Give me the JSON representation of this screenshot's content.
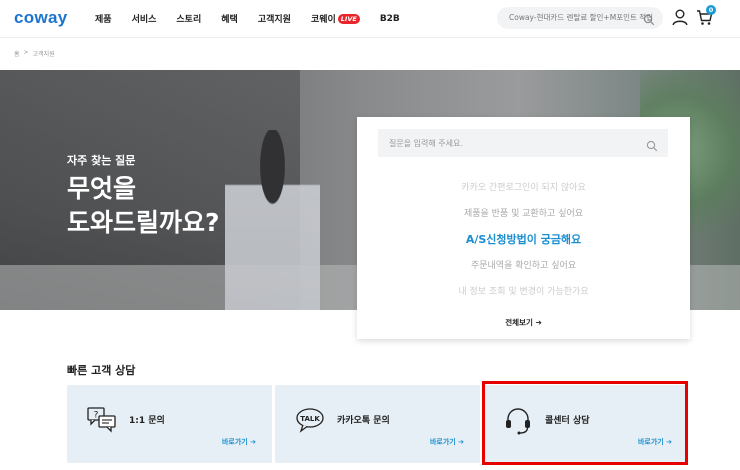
{
  "header": {
    "logo": "coway",
    "nav": [
      "제품",
      "서비스",
      "스토리",
      "혜택",
      "고객지원",
      "코웨이"
    ],
    "live_badge": "LIVE",
    "nav_b2b": "B2B",
    "search_text": "Coway-현대카드 렌탈료 할인+M포인트 적립",
    "cart_count": "0"
  },
  "breadcrumb": [
    "홈",
    ">",
    "고객지원"
  ],
  "hero": {
    "subtitle": "자주 찾는 질문",
    "title_line1": "무엇을",
    "title_line2": "도와드릴까요?"
  },
  "faq": {
    "placeholder": "질문을 입력해 주세요.",
    "items": [
      "카카오 간편로그인이 되지 않아요",
      "제품을 반품 및 교환하고 싶어요",
      "A/S신청방법이 궁금해요",
      "주문내역을 확인하고 싶어요",
      "내 정보 조회 및 변경이 가능한가요"
    ],
    "view_all": "전체보기 ➔"
  },
  "quick": {
    "title": "빠른 고객 상담",
    "cards": [
      {
        "label": "1:1 문의",
        "link": "바로가기 ➔",
        "icon": "chat-bubbles-icon"
      },
      {
        "label": "카카오톡 문의",
        "link": "바로가기 ➔",
        "icon": "talk-icon"
      },
      {
        "label": "콜센터 상담",
        "link": "바로가기 ➔",
        "icon": "headset-icon"
      }
    ]
  },
  "colors": {
    "brand": "#1b75d0",
    "accent": "#1a8ed0",
    "live": "#e8262c",
    "highlight": "#e60000"
  }
}
